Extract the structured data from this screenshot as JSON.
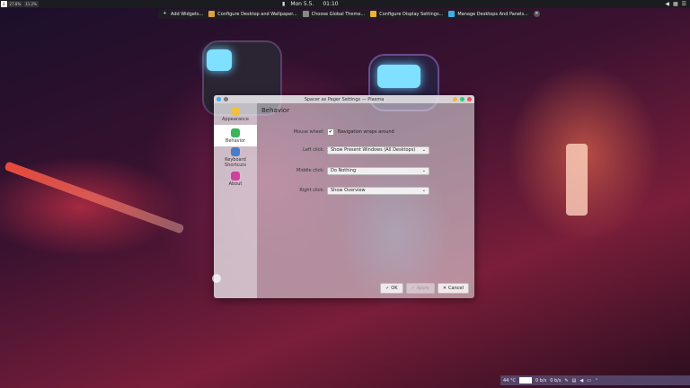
{
  "top_panel": {
    "pagers": [
      "2",
      "27.8%",
      "11.2%"
    ],
    "date": "Mon 5.5.",
    "time": "01:10"
  },
  "edit_toolbar": {
    "items": [
      {
        "label": "Add Widgets...",
        "icon": "plus-icon"
      },
      {
        "label": "Configure Desktop and Wallpaper...",
        "icon": "desktop-icon"
      },
      {
        "label": "Choose Global Theme...",
        "icon": "theme-icon"
      },
      {
        "label": "Configure Display Settings...",
        "icon": "display-icon"
      },
      {
        "label": "Manage Desktops And Panels...",
        "icon": "panels-icon"
      }
    ]
  },
  "dialog": {
    "title": "Spacer as Pager Settings — Plasma",
    "sidebar": [
      {
        "label": "Appearance",
        "icon": "appearance-icon",
        "active": false
      },
      {
        "label": "Behavior",
        "icon": "behavior-icon",
        "active": true
      },
      {
        "label": "Keyboard Shortcuts",
        "icon": "keyboard-icon",
        "active": false
      },
      {
        "label": "About",
        "icon": "about-icon",
        "active": false
      }
    ],
    "page_title": "Behavior",
    "mouse_wheel_label": "Mouse wheel:",
    "mouse_wheel_option": "Navigation wraps around",
    "mouse_wheel_checked": true,
    "left_click_label": "Left click:",
    "left_click_value": "Show Present Windows (All Desktops)",
    "middle_click_label": "Middle click:",
    "middle_click_value": "Do Nothing",
    "right_click_label": "Right click:",
    "right_click_value": "Show Overview",
    "ok_label": "OK",
    "apply_label": "Apply",
    "cancel_label": "Cancel"
  },
  "bottom_panel": {
    "temperature": "44 °C",
    "net_down": "0 b/s",
    "net_up": "0 b/s"
  },
  "colors": {
    "accent": "#3daee9",
    "close": "#ed5656",
    "minimize": "#f3b43b",
    "maximize": "#2ecc71"
  }
}
